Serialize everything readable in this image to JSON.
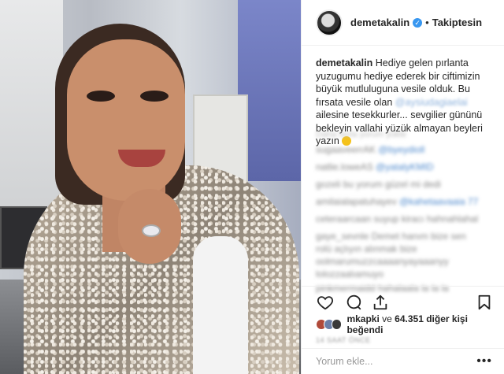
{
  "post": {
    "username": "demetakalin",
    "follow_label": "Takiptesin",
    "separator": "•",
    "caption_lines": [
      "Hediye gelen pırlanta",
      "yuzugumu hediye ederek bir ciftimizin",
      "büyük mutluluguna vesile olduk. Bu fırsata",
      "vesile olan",
      "ailesine",
      "tesekkurler... sevgilier gününü bekleyin",
      "vallahi yüzük almayan beyleri yazın"
    ],
    "caption_tag": "@aysiudagiaelai",
    "view_all_comments": "Daha fazla yorum yükle",
    "comments": [
      {
        "user": "sugaaveerrAK",
        "text": "@byeydioll"
      },
      {
        "user": "natlie.loweAS",
        "text": "@yatalyKMID"
      },
      {
        "user": "gozeli",
        "text": "bu yorum güzel mi dedi"
      },
      {
        "user": "amilaialapatuhayev",
        "text": "@kahetaavaaia 77"
      },
      {
        "user": "ceteraarcaan",
        "text": "suyup kiracı hahnahlahal"
      },
      {
        "user": "gaye_sevnle",
        "text": "Demet hanım bize sen"
      },
      {
        "user": "",
        "text": "rolü açlıyın alınmak bize"
      },
      {
        "user": "",
        "text": "oolmarumuzzcaaaanyayaaanyy"
      },
      {
        "user": "",
        "text": "lolozzaalıamuyo"
      },
      {
        "user": "pinkmermaidd",
        "text": "hahalaala la la la"
      }
    ],
    "likes_user": "mkapki",
    "likes_connector": "ve",
    "likes_count": "64.351",
    "likes_suffix": "diğer kişi beğendi",
    "timestamp": "14 SAAT ÖNCE",
    "add_comment_placeholder": "Yorum ekle...",
    "more_glyph": "•••"
  },
  "colors": {
    "verified": "#3897f0",
    "text": "#262626",
    "border": "#efefef",
    "muted": "#999999"
  },
  "icons": [
    "heart-icon",
    "comment-icon",
    "share-icon",
    "save-icon",
    "verified-icon",
    "more-icon"
  ]
}
